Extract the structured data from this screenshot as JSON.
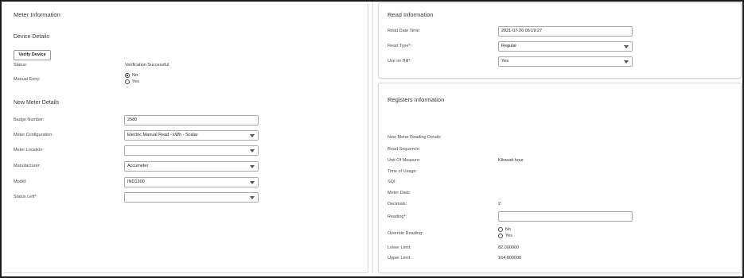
{
  "meter_info": {
    "title": "Meter Information",
    "device_details": {
      "heading": "Device Details",
      "verify_button": "Verify Device",
      "status_label": "Status:",
      "status_value": "Verification Successful",
      "manual_entry_label": "Manual Entry:",
      "manual_entry_options": [
        "No",
        "Yes"
      ],
      "manual_entry_selected": "No"
    },
    "new_meter": {
      "heading": "New Meter Details",
      "badge_number_label": "Badge Number:",
      "badge_number_value": "2580",
      "configuration_label": "Meter Configuration:",
      "configuration_value": "Electric Manual Read - kWh - Scalar",
      "location_label": "Meter Location:",
      "location_value": "",
      "manufacturer_label": "Manufacturer:",
      "manufacturer_value": "Accumeter",
      "model_label": "Model:",
      "model_value": "IND1300",
      "status_left_label": "Status Left*:",
      "status_left_value": ""
    }
  },
  "read_info": {
    "title": "Read Information",
    "date_time_label": "Read Date Time:",
    "date_time_value": "2021-07-26 06:19:27",
    "read_type_label": "Read Type*:",
    "read_type_value": "Regular",
    "use_on_bill_label": "Use on Bill*:",
    "use_on_bill_value": "Yes"
  },
  "registers": {
    "title": "Registers Information",
    "subheading": "New Meter Reading Details",
    "read_sequence_label": "Read Sequence:",
    "uom_label": "Unit Of Measure:",
    "uom_value": "Kilowatt hour",
    "time_of_usage_label": "Time of Usage:",
    "sqi_label": "SQI:",
    "meter_dials_label": "Meter Dials:",
    "decimals_label": "Decimals:",
    "decimals_value": "2",
    "reading_label": "Reading*:",
    "reading_value": "",
    "override_label": "Override Reading:",
    "override_options": [
      "No",
      "Yes"
    ],
    "override_selected": "No",
    "lower_limit_label": "Lower Limit:",
    "lower_limit_value": "82.000000",
    "upper_limit_label": "Upper Limit:",
    "upper_limit_value": "164.000000"
  }
}
